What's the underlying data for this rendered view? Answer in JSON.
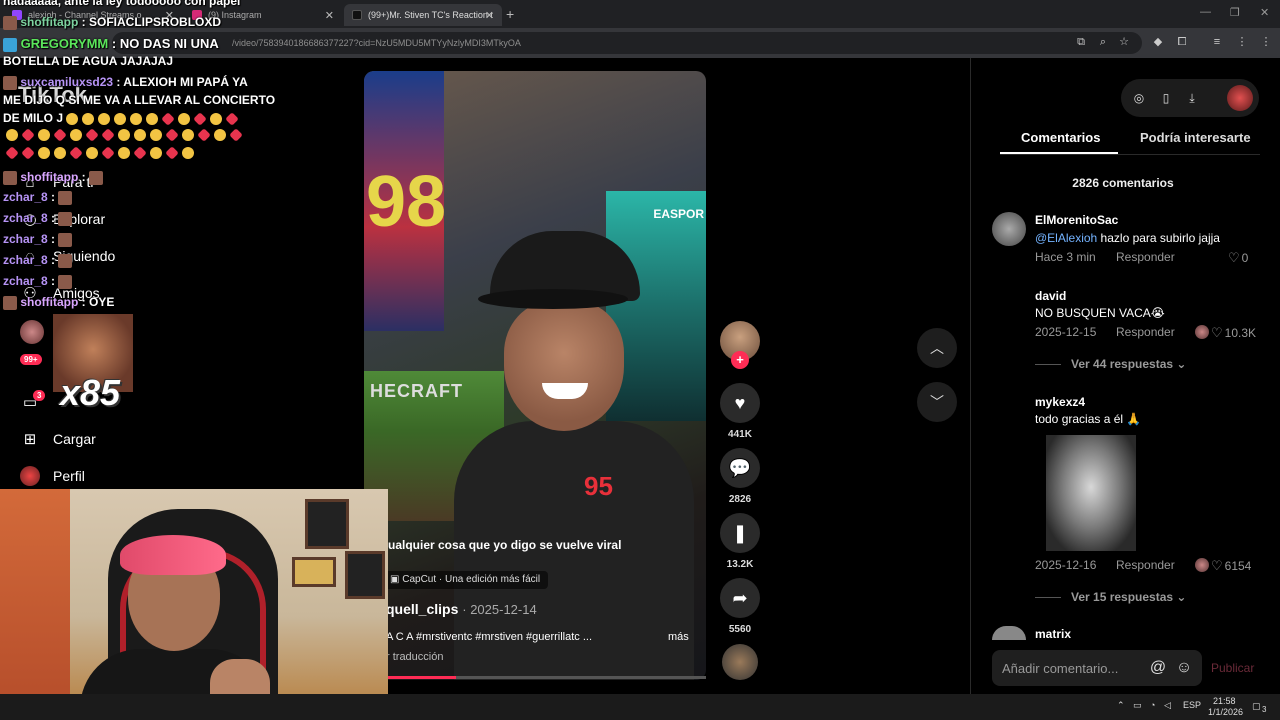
{
  "browser": {
    "tabs": [
      {
        "title": "alexioh - Channel Streams o"
      },
      {
        "title": "(9) Instagram"
      },
      {
        "title": "(99+)Mr. Stiven TC's Reaction t"
      }
    ],
    "url": "/video/7583940186686377227?cid=NzU5MDU5MTYyNzlyMDI3MTkyOA"
  },
  "tiktok": {
    "logo": "TikTok",
    "nav": [
      {
        "label": "Para ti",
        "icon": "home-icon"
      },
      {
        "label": "Explorar",
        "icon": "compass-icon"
      },
      {
        "label": "Siguiendo",
        "icon": "following-icon"
      },
      {
        "label": "Amigos",
        "icon": "friends-icon"
      },
      {
        "label": "Cargar",
        "icon": "upload-icon"
      },
      {
        "label": "Perfil",
        "icon": "profile-icon"
      }
    ],
    "badges": {
      "activity": "99+",
      "messages": "3"
    },
    "video": {
      "caption": "ualquier cosa que yo digo se vuelve viral",
      "capcut": "CapCut · Una edición más fácil",
      "author": "quell_clips",
      "date": "2025-12-14",
      "description": "A C A #mrstiventc #mrstiven #guerrillatc ...",
      "more": "más",
      "translate": "r traducción",
      "poster_98": "98",
      "poster_ea": "EASPOR",
      "minecraft": "HECRAFT",
      "jersey_num": "95",
      "progress": 0.27
    },
    "actions": {
      "likes": "441K",
      "comments": "2826",
      "saves": "13.2K",
      "shares": "5560"
    },
    "right_panel": {
      "tab_comments": "Comentarios",
      "tab_related": "Podría interesarte",
      "comment_count": "2826 comentarios",
      "comments": [
        {
          "user": "ElMorenitoSac",
          "mention": "@ElAlexioh",
          "text": " hazlo para subirlo jajja",
          "time": "Hace 3 min",
          "reply": "Responder",
          "likes": "0"
        },
        {
          "user": "david",
          "text": "NO BUSQUEN VACA😭",
          "time": "2025-12-15",
          "reply": "Responder",
          "likes": "10.3K",
          "view_replies": "Ver 44 respuestas"
        },
        {
          "user": "mykexz4",
          "text": "todo gracias a él 🙏",
          "time": "2025-12-16",
          "reply": "Responder",
          "likes": "6154",
          "view_replies": "Ver 15 respuestas"
        },
        {
          "user": "matrix"
        }
      ],
      "input_placeholder": "Añadir comentario...",
      "publish": "Publicar"
    }
  },
  "stream_overlay": {
    "chat": [
      {
        "user": "",
        "text": "nadaaaaa, ante la ley todooooo con papel"
      },
      {
        "user": "shoffitapp",
        "text": "SOFIACLIPSROBLOXD"
      },
      {
        "user": "GREGORYMM",
        "text": "NO DAS NI UNA"
      },
      {
        "user": "",
        "text": "BOTELLA DE AGUA JAJAJAJ"
      },
      {
        "user": "suxcamiluxsd23",
        "text": "ALEXIOH MI PAPÁ YA"
      },
      {
        "user": "",
        "text": "ME DIJO Q SI ME VA A LLEVAR AL CONCIERTO"
      },
      {
        "user": "",
        "text": "DE MILO J"
      },
      {
        "user": "shoffitapp",
        "text": ""
      },
      {
        "user": "zchar_8",
        "text": ""
      },
      {
        "user": "zchar_8",
        "text": ""
      },
      {
        "user": "zchar_8",
        "text": ""
      },
      {
        "user": "zchar_8",
        "text": ""
      },
      {
        "user": "zchar_8",
        "text": ""
      },
      {
        "user": "shoffitapp",
        "text": "OYE"
      }
    ],
    "multiplier": "x85"
  },
  "taskbar": {
    "lang": "ESP",
    "time": "21:58",
    "date": "1/1/2026",
    "notif": "3"
  },
  "colors": {
    "tiktok_red": "#fe2c55",
    "mention_blue": "#74b3ff",
    "chat_green": "#5be65b"
  }
}
